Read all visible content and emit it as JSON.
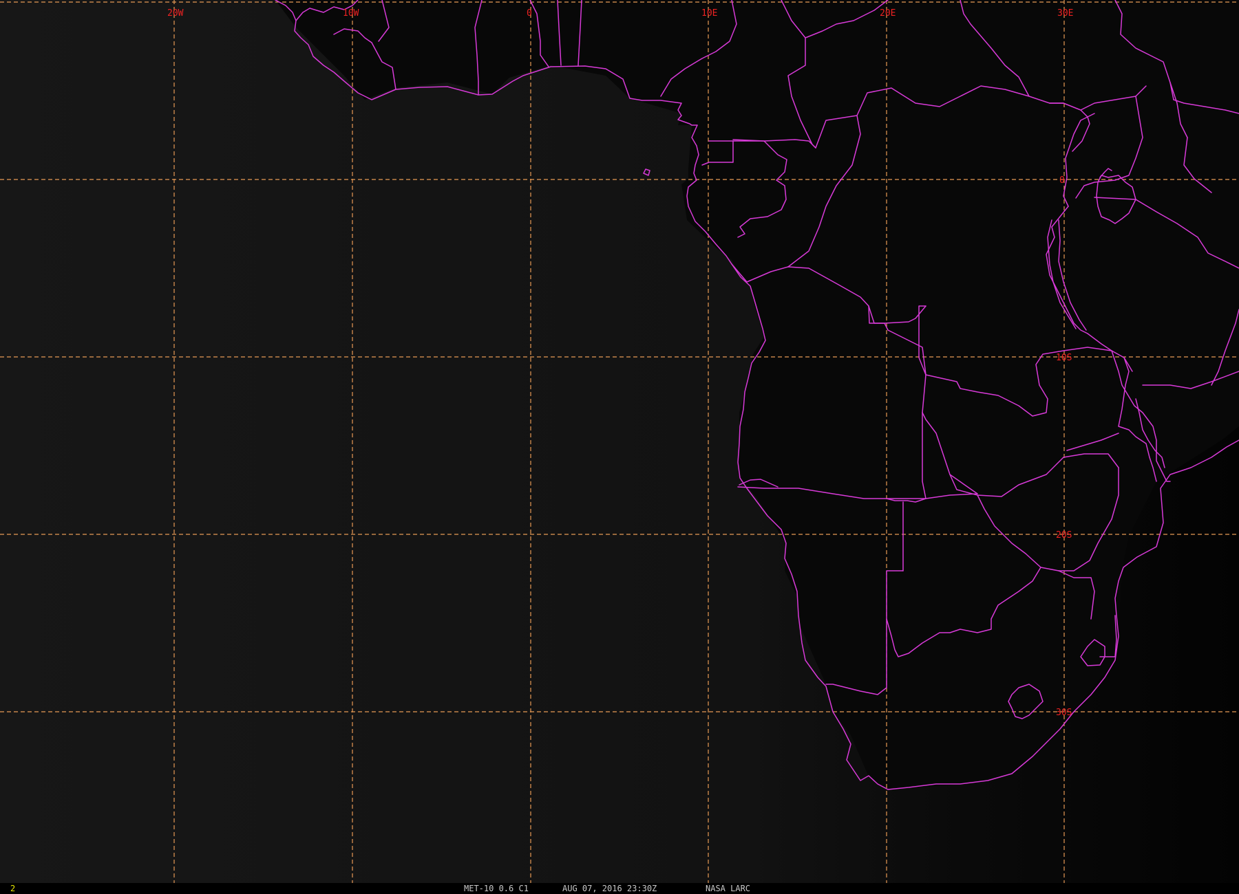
{
  "colors": {
    "background_ocean": "#141414",
    "background_land": "#060606",
    "grid": "#e89a55",
    "grid_label": "#ee2222",
    "borders": "#d83ad8",
    "frame_number": "#e6e600",
    "status_text": "#c8c8c8"
  },
  "map": {
    "projection": "satellite geostationary view",
    "grid_spacing_degrees": 10,
    "graticule": {
      "longitude_labels": [
        "20W",
        "10W",
        "0",
        "10E",
        "20E",
        "30E"
      ],
      "latitude_labels": [
        "0",
        "10S",
        "20S",
        "30S"
      ]
    },
    "icons": {
      "grid": "dashed-graticule",
      "borders": "political-boundary-lines"
    }
  },
  "status_bar": {
    "frame_number": "2",
    "satellite_channel": "MET-10 0.6 C1",
    "datetime": "AUG 07, 2016 23:30Z",
    "source": "NASA LARC"
  }
}
